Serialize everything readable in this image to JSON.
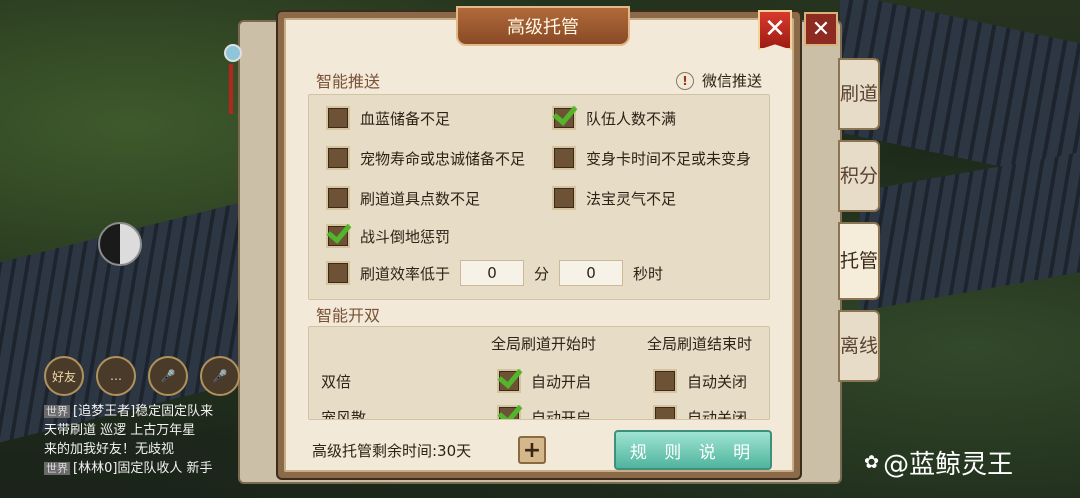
{
  "dialog": {
    "title": "高级托管"
  },
  "smart_push": {
    "title": "智能推送",
    "wechat_label": "微信推送",
    "options": [
      {
        "label": "血蓝储备不足",
        "checked": false
      },
      {
        "label": "队伍人数不满",
        "checked": true
      },
      {
        "label": "宠物寿命或忠诚储备不足",
        "checked": false
      },
      {
        "label": "变身卡时间不足或未变身",
        "checked": false
      },
      {
        "label": "刷道道具点数不足",
        "checked": false
      },
      {
        "label": "法宝灵气不足",
        "checked": false
      },
      {
        "label": "战斗倒地惩罚",
        "checked": true
      }
    ],
    "efficiency": {
      "label": "刷道效率低于",
      "checked": false,
      "minutes_value": "0",
      "minutes_unit": "分",
      "seconds_value": "0",
      "seconds_unit": "秒时"
    }
  },
  "smart_double": {
    "title": "智能开双",
    "col_start": "全局刷道开始时",
    "col_end": "全局刷道结束时",
    "rows": [
      {
        "label": "双倍",
        "start_label": "自动开启",
        "start_checked": true,
        "end_label": "自动关闭",
        "end_checked": false
      },
      {
        "label": "宠风散",
        "start_label": "自动开启",
        "start_checked": true,
        "end_label": "自动关闭",
        "end_checked": false
      }
    ]
  },
  "footer": {
    "remaining_time": "高级托管剩余时间:30天",
    "rules_button": "规 则 说 明"
  },
  "side_tabs": [
    "刷道",
    "积分",
    "托管",
    "离线"
  ],
  "chat": {
    "icons": [
      "好友",
      "…",
      "",
      ""
    ],
    "messages": [
      {
        "tag": "世界",
        "text": "[追梦王者]稳定固定队来"
      },
      {
        "tag": "",
        "text": "天带刷道 巡逻 上古万年星"
      },
      {
        "tag": "",
        "text": "来的加我好友！无歧视"
      },
      {
        "tag": "世界",
        "text": "[林林0]固定队收人 新手"
      }
    ]
  },
  "watermark": "@蓝鲸灵王",
  "colors": {
    "check_green": "#52b52a",
    "close_red": "#c62a20",
    "rule_button": "#6cc9b2"
  }
}
